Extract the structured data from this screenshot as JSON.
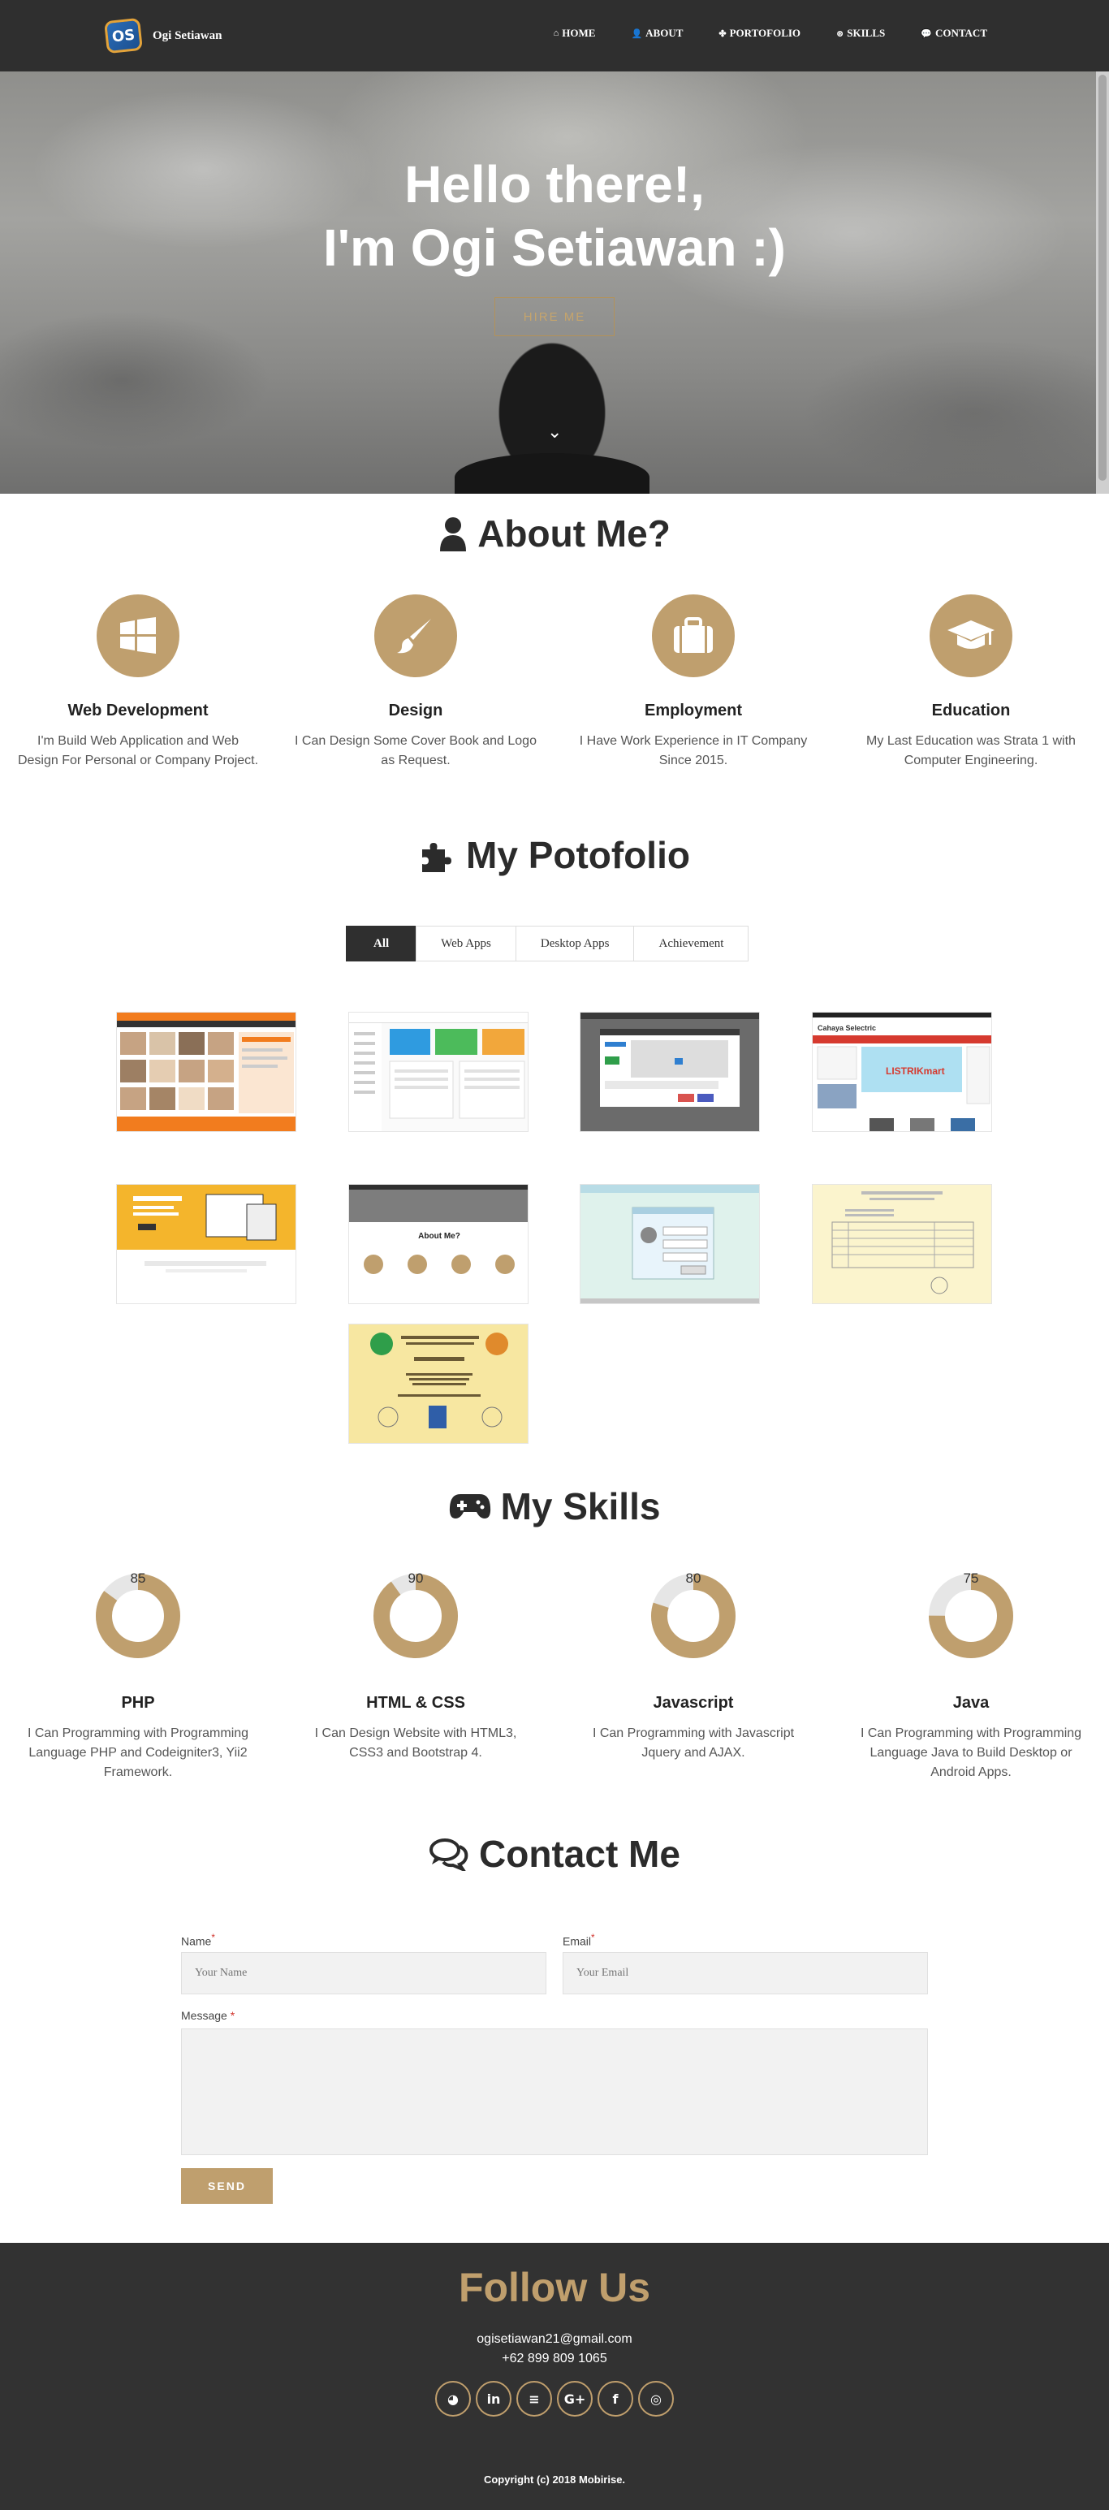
{
  "nav": {
    "logo_text": "OS",
    "brand": "Ogi Setiawan",
    "links": [
      {
        "icon": "home-icon",
        "label": "HOME"
      },
      {
        "icon": "user-icon",
        "label": "ABOUT"
      },
      {
        "icon": "puzzle-icon",
        "label": "PORTOFOLIO"
      },
      {
        "icon": "gamepad-icon",
        "label": "SKILLS"
      },
      {
        "icon": "chat-icon",
        "label": "CONTACT"
      }
    ]
  },
  "hero": {
    "line1": "Hello there!,",
    "line2": "I'm Ogi Setiawan :)",
    "button": "HIRE ME"
  },
  "about": {
    "title": "About Me?",
    "features": [
      {
        "icon": "windows-icon",
        "title": "Web Development",
        "text": "I'm Build Web Application and Web Design For Personal or Company Project."
      },
      {
        "icon": "paintbrush-icon",
        "title": "Design",
        "text": "I Can Design Some Cover Book and Logo as Request."
      },
      {
        "icon": "briefcase-icon",
        "title": "Employment",
        "text": "I Have Work Experience in IT Company Since 2015."
      },
      {
        "icon": "graduation-cap-icon",
        "title": "Education",
        "text": "My Last Education was Strata 1 with Computer Engineering."
      }
    ]
  },
  "portfolio": {
    "title": "My Potofolio",
    "filters": [
      "All",
      "Web Apps",
      "Desktop Apps",
      "Achievement"
    ],
    "active_filter": "All",
    "thumbs": [
      "web-app-orange-dashboard",
      "web-app-admin-panel",
      "desktop-app-calendar-dialog",
      "web-app-cahaya-electric",
      "web-app-yellow-landing",
      "web-app-portfolio-site",
      "desktop-app-login-window",
      "achievement-certificate-table",
      "achievement-certificate-award"
    ],
    "cahaya_label": "Cahaya Selectric",
    "listrik_label": "LISTRIKmart",
    "about_label": "About Me?"
  },
  "skills": {
    "title": "My Skills",
    "accent": "#bf9f6e",
    "track": "#e6e6e6",
    "items": [
      {
        "name": "PHP",
        "value": 85,
        "text": "I Can Programming with Programming Language PHP and Codeigniter3, Yii2 Framework."
      },
      {
        "name": "HTML & CSS",
        "value": 90,
        "text": "I Can Design Website with HTML3, CSS3 and Bootstrap 4."
      },
      {
        "name": "Javascript",
        "value": 80,
        "text": "I Can Programming with Javascript Jquery and AJAX."
      },
      {
        "name": "Java",
        "value": 75,
        "text": "I Can Programming with Programming Language Java to Build Desktop or Android Apps."
      }
    ]
  },
  "contact": {
    "title": "Contact Me",
    "name_label": "Name",
    "name_placeholder": "Your Name",
    "email_label": "Email",
    "email_placeholder": "Your Email",
    "message_label": "Message",
    "required_mark": "*",
    "send": "SEND"
  },
  "footer": {
    "title": "Follow Us",
    "email": "ogisetiawan21@gmail.com",
    "phone": "+62 899 809 1065",
    "socials": [
      {
        "icon": "github-icon",
        "glyph": "◕"
      },
      {
        "icon": "linkedin-icon",
        "glyph": "in"
      },
      {
        "icon": "stack-overflow-icon",
        "glyph": "≡"
      },
      {
        "icon": "google-plus-icon",
        "glyph": "G+"
      },
      {
        "icon": "facebook-icon",
        "glyph": "f"
      },
      {
        "icon": "instagram-icon",
        "glyph": "◎"
      }
    ],
    "copyright": "Copyright (c) 2018 Mobirise."
  }
}
